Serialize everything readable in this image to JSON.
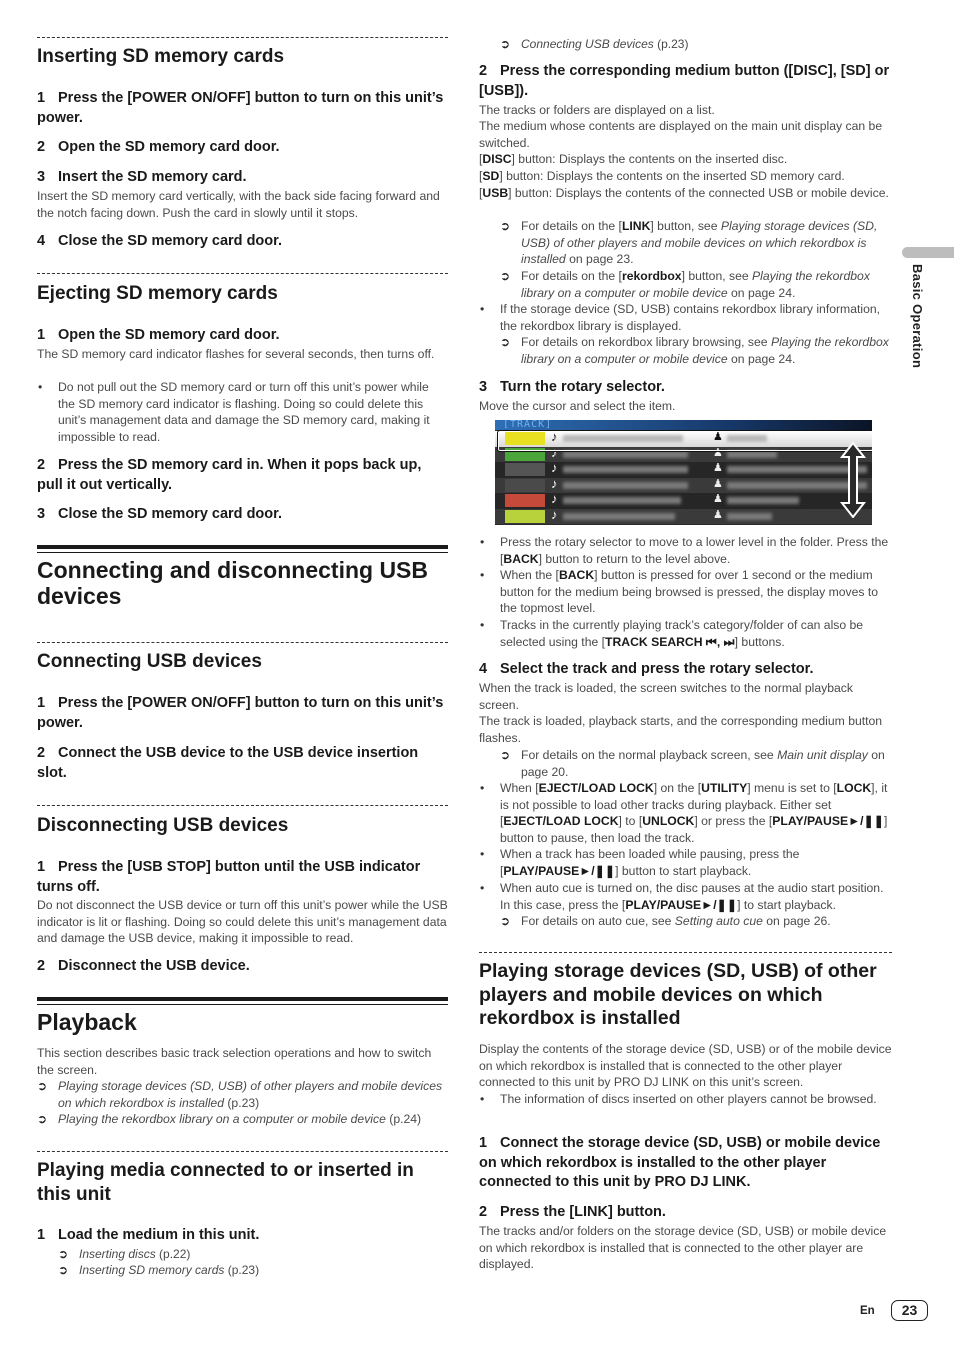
{
  "left": {
    "inserting": {
      "title": "Inserting SD memory cards",
      "steps": [
        {
          "num": "1",
          "text": "Press the [POWER ON/OFF] button to turn on this unit’s power."
        },
        {
          "num": "2",
          "text": "Open the SD memory card door."
        },
        {
          "num": "3",
          "text": "Insert the SD memory card.",
          "body": "Insert the SD memory card vertically, with the back side facing forward and the notch facing down. Push the card in slowly until it stops."
        },
        {
          "num": "4",
          "text": "Close the SD memory card door."
        }
      ]
    },
    "ejecting": {
      "title": "Ejecting SD memory cards",
      "steps": [
        {
          "num": "1",
          "text": "Open the SD memory card door.",
          "body": "The SD memory card indicator flashes for several seconds, then turns off.",
          "bullet": "Do not pull out the SD memory card or turn off this unit’s power while the SD memory card indicator is flashing. Doing so could delete this unit’s management data and damage the SD memory card, making it impossible to read."
        },
        {
          "num": "2",
          "text": "Press the SD memory card in. When it pops back up, pull it out vertically."
        },
        {
          "num": "3",
          "text": "Close the SD memory card door."
        }
      ]
    },
    "usb_section": {
      "title": "Connecting and disconnecting USB devices",
      "connecting": {
        "title": "Connecting USB devices",
        "steps": [
          {
            "num": "1",
            "text": "Press the [POWER ON/OFF] button to turn on this unit’s power."
          },
          {
            "num": "2",
            "text": "Connect the USB device to the USB device insertion slot."
          }
        ]
      },
      "disconnecting": {
        "title": "Disconnecting USB devices",
        "steps": [
          {
            "num": "1",
            "text": "Press the [USB STOP] button until the USB indicator turns off.",
            "body": "Do not disconnect the USB device or turn off this unit’s power while the USB indicator is lit or flashing. Doing so could delete this unit’s management data and damage the USB device, making it impossible to read."
          },
          {
            "num": "2",
            "text": "Disconnect the USB device."
          }
        ]
      }
    },
    "playback": {
      "title": "Playback",
      "intro": "This section describes basic track selection operations and how to switch the screen.",
      "refs": [
        {
          "italic": "Playing storage devices (SD, USB) of other players and mobile devices on which rekordbox is installed",
          "page": "(p.23)"
        },
        {
          "italic": "Playing the rekordbox library on a computer or mobile device",
          "page": "(p.24)"
        }
      ],
      "media": {
        "title": "Playing media connected to or inserted in this unit",
        "step1": {
          "num": "1",
          "text": "Load the medium in this unit."
        },
        "refs": [
          {
            "italic": "Inserting discs",
            "page": "(p.22)"
          },
          {
            "italic": "Inserting SD memory cards",
            "page": "(p.23)"
          }
        ]
      }
    }
  },
  "right": {
    "top_ref": {
      "italic": "Connecting USB devices",
      "page": "(p.23)"
    },
    "step2": {
      "num": "2",
      "text": "Press the corresponding medium button ([DISC], [SD] or [USB]).",
      "body1": "The tracks or folders are displayed on a list.",
      "body2": "The medium whose contents are displayed on the main unit display can be switched.",
      "disc": {
        "key": "DISC",
        "desc": "button: Displays the contents on the inserted disc."
      },
      "sd": {
        "key": "SD",
        "desc": "button: Displays the contents on the inserted SD memory card."
      },
      "usb": {
        "key": "USB",
        "desc": "button: Displays the contents of the connected USB or mobile device."
      },
      "ref_link": {
        "pre": "For details on the [",
        "key": "LINK",
        "mid": "] button, see ",
        "italic": "Playing storage devices (SD, USB) of other players and mobile devices on which rekordbox is installed",
        "post": " on page 23."
      },
      "ref_rekordbox": {
        "pre": "For details on the [",
        "key": "rekordbox",
        "mid": "] button, see ",
        "italic": "Playing the rekordbox library on a computer or mobile device",
        "post": " on page 24."
      },
      "bullet": "If the storage device (SD, USB) contains rekordbox library information, the rekordbox library is displayed.",
      "ref_browse": {
        "pre": "For details on rekordbox library browsing, see ",
        "italic": "Playing the rekordbox library on a computer or mobile device",
        "post": " on page 24."
      }
    },
    "step3": {
      "num": "3",
      "text": "Turn the rotary selector.",
      "body": "Move the cursor and select the item.",
      "display": {
        "header": "[TRACK]",
        "rows": 6,
        "selected_row": 1,
        "thumb_colors": [
          "#e8e020",
          "#4aa63a",
          "#555555",
          "#4a4a4a",
          "#c64a3a",
          "#b7d23a"
        ]
      },
      "bullets": [
        {
          "pre": "Press the rotary selector to move to a lower level in the folder. Press the [",
          "key": "BACK",
          "post": "] button to return to the level above."
        },
        {
          "pre": "When the [",
          "key": "BACK",
          "post": "] button is pressed for over 1 second or the medium button for the medium being browsed is pressed, the display moves to the topmost level."
        },
        {
          "pre": "Tracks in the currently playing track’s category/folder of can also be selected using the [",
          "key": "TRACK SEARCH ⏮, ⏭",
          "post": "] buttons."
        }
      ]
    },
    "step4": {
      "num": "4",
      "text": "Select the track and press the rotary selector.",
      "body1": "When the track is loaded, the screen switches to the normal playback screen.",
      "body2": "The track is loaded, playback starts, and the corresponding medium button flashes.",
      "ref_main": {
        "pre": "For details on the normal playback screen, see ",
        "italic": "Main unit display",
        "post": " on page 20."
      },
      "b1": {
        "t1": "When [",
        "k1": "EJECT/LOAD LOCK",
        "t2": "] on the [",
        "k2": "UTILITY",
        "t3": "] menu is set to [",
        "k3": "LOCK",
        "t4": "], it is not possible to load other tracks during playback. Either set [",
        "k4": "EJECT/LOAD LOCK",
        "t5": "] to [",
        "k5": "UNLOCK",
        "t6": "] or press the [",
        "k6": "PLAY/PAUSE►/❚❚",
        "t7": "] button to pause, then load the track."
      },
      "b2": {
        "t1": "When a track has been loaded while pausing, press the [",
        "k1": "PLAY/PAUSE►/❚❚",
        "t2": "] button to start playback."
      },
      "b3": {
        "t1": "When auto cue is turned on, the disc pauses at the audio start position. In this case, press the [",
        "k1": "PLAY/PAUSE►/❚❚",
        "t2": "] to start playback."
      },
      "ref_cue": {
        "pre": "For details on auto cue, see ",
        "italic": "Setting auto cue",
        "post": " on page 26."
      }
    },
    "link_section": {
      "title": "Playing storage devices (SD, USB) of other players and mobile devices on which rekordbox is installed",
      "intro": "Display the contents of the storage device (SD, USB) or of the mobile device on which rekordbox is installed that is connected to the other player connected to this unit by PRO DJ LINK on this unit’s screen.",
      "bullet": "The information of discs inserted on other players cannot be browsed.",
      "step1": {
        "num": "1",
        "text": "Connect the storage device (SD, USB) or mobile device on which rekordbox is installed to the other player connected to this unit by PRO DJ LINK."
      },
      "step2": {
        "num": "2",
        "text": "Press the [LINK] button.",
        "body": "The tracks and/or folders on the storage device (SD, USB) or mobile device on which rekordbox is installed that is connected to the other player are displayed."
      }
    }
  },
  "side_tab": {
    "label": "Basic Operation"
  },
  "footer": {
    "lang": "En",
    "page": "23"
  },
  "ref_arrow": "➲"
}
